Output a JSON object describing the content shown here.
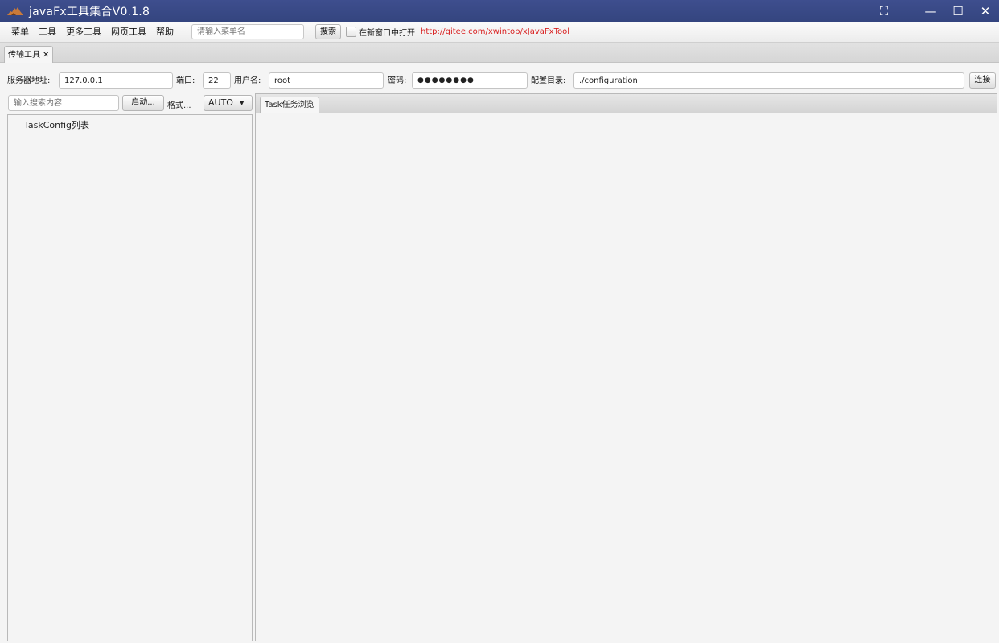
{
  "window": {
    "title": "javaFx工具集合V0.1.8",
    "controls": {
      "fullscreen": "⛶",
      "minimize": "—",
      "maximize": "☐",
      "close": "✕"
    }
  },
  "menubar": {
    "items": [
      "菜单",
      "工具",
      "更多工具",
      "网页工具",
      "帮助"
    ],
    "search_placeholder": "请输入菜单名",
    "search_button": "搜索",
    "open_new_window_label": "在新窗口中打开",
    "open_new_window_checked": false,
    "link": "http://gitee.com/xwintop/xJavaFxTool",
    "link_color": "#d81e1e"
  },
  "tabs": [
    {
      "label": "传输工具",
      "close": "✕"
    }
  ],
  "config": {
    "server_label": "服务器地址:",
    "server_value": "127.0.0.1",
    "port_label": "端口:",
    "port_value": "22",
    "user_label": "用户名:",
    "user_value": "root",
    "password_label": "密码:",
    "password_value": "●●●●●●●●",
    "dir_label": "配置目录:",
    "dir_value": "./configuration",
    "connect_button": "连接"
  },
  "left": {
    "search_placeholder": "输入搜索内容",
    "start_button": "启动...",
    "format_label": "格式...",
    "format_select": "AUTO",
    "tree_items": [
      "TaskConfig列表"
    ]
  },
  "right": {
    "tab_label": "Task任务浏览"
  },
  "colors": {
    "titlebar": "#3a4a89",
    "accent_link": "#d81e1e"
  }
}
